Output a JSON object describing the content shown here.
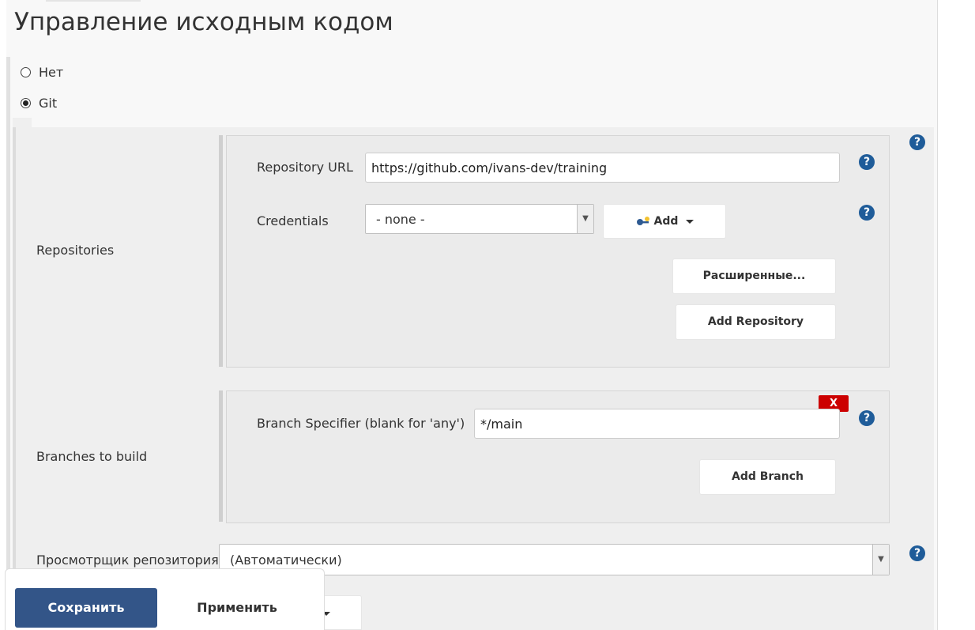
{
  "section": {
    "title": "Управление исходным кодом"
  },
  "scm_options": [
    {
      "label": "Нет",
      "selected": false
    },
    {
      "label": "Git",
      "selected": true
    }
  ],
  "repositories": {
    "label": "Repositories",
    "url_label": "Repository URL",
    "url_value": "https://github.com/ivans-dev/training",
    "credentials_label": "Credentials",
    "credentials_value": "- none -",
    "add_label": "Add",
    "advanced_label": "Расширенные...",
    "add_repository_label": "Add Repository"
  },
  "branches": {
    "label": "Branches to build",
    "specifier_label": "Branch Specifier (blank for 'any')",
    "specifier_value": "*/main",
    "delete_label": "X",
    "add_branch_label": "Add Branch"
  },
  "repo_browser": {
    "label": "Просмотрщик репозитория",
    "value": "(Автоматически)"
  },
  "help": {
    "symbol": "?"
  },
  "footer": {
    "save_label": "Сохранить",
    "apply_label": "Применить"
  },
  "colors": {
    "primary_button": "#335588",
    "help_icon": "#1f5c99",
    "delete_button": "#cc0000"
  }
}
